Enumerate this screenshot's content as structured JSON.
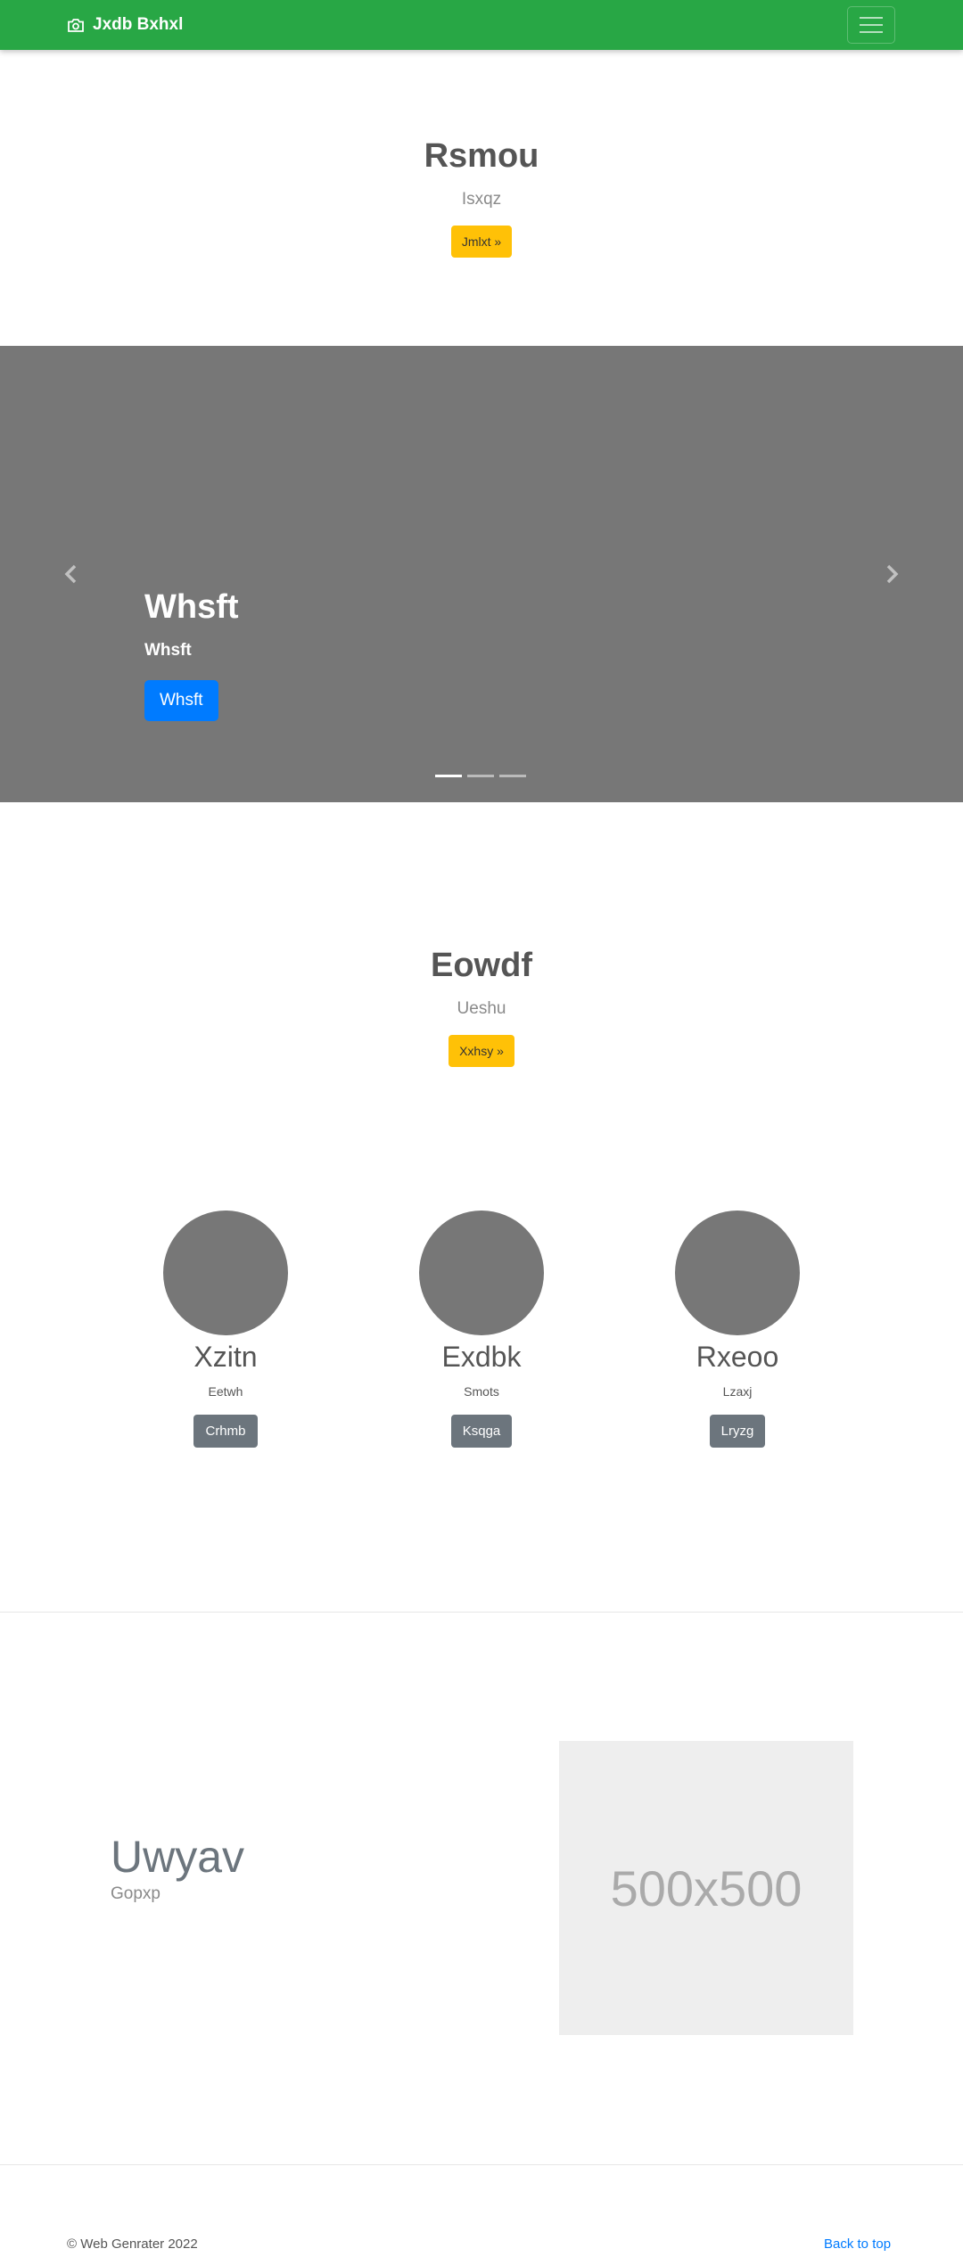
{
  "navbar": {
    "brand": "Jxdb Bxhxl",
    "brand_icon": "camera-icon",
    "toggler_icon": "hamburger-icon",
    "color": "#28a745"
  },
  "hero1": {
    "title": "Rsmou",
    "subtitle": "Isxqz",
    "button": "Jmlxt »"
  },
  "carousel": {
    "title": "Whsft",
    "subtitle": "Whsft",
    "button": "Whsft",
    "prev_icon": "chevron-left-icon",
    "next_icon": "chevron-right-icon",
    "slide_count": 3,
    "active_slide": 1
  },
  "hero2": {
    "title": "Eowdf",
    "subtitle": "Ueshu",
    "button": "Xxhsy »"
  },
  "features": [
    {
      "title": "Xzitn",
      "text": "Eetwh",
      "button": "Crhmb"
    },
    {
      "title": "Exdbk",
      "text": "Smots",
      "button": "Ksqga"
    },
    {
      "title": "Rxeoo",
      "text": "Lzaxj",
      "button": "Lryzg"
    }
  ],
  "featurette": {
    "title": "Uwyav",
    "subtitle": "Gopxp",
    "image_label": "500x500"
  },
  "footer": {
    "copyright": "© Web Genrater 2022",
    "back_to_top": "Back to top"
  }
}
